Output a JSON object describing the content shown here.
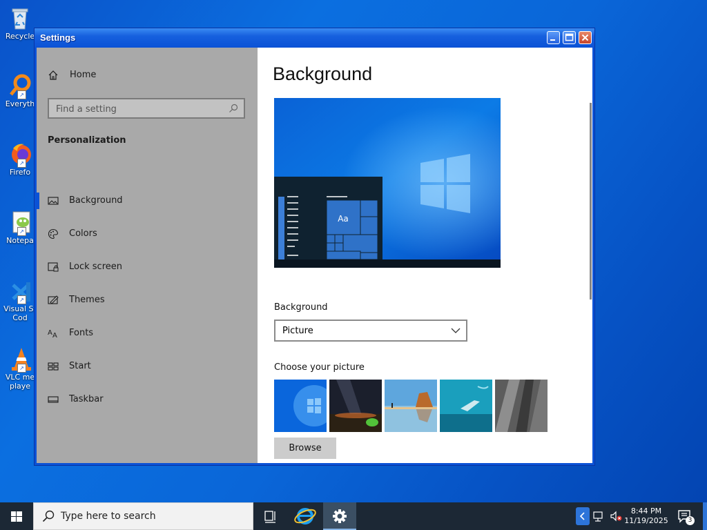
{
  "desktop": {
    "icons": [
      {
        "label": "Recycle",
        "icon": "recycle-bin-icon"
      },
      {
        "label": "Everyth",
        "icon": "everything-search-icon"
      },
      {
        "label": "Firefo",
        "icon": "firefox-icon"
      },
      {
        "label": "Notepa",
        "icon": "notepad-plus-plus-icon"
      },
      {
        "label": "Visual St Cod",
        "icon": "vscode-icon"
      },
      {
        "label": "VLC me playe",
        "icon": "vlc-icon"
      }
    ]
  },
  "window": {
    "title": "Settings",
    "controls": {
      "minimize": "minimize-icon",
      "maximize": "maximize-icon",
      "close": "close-icon"
    }
  },
  "nav": {
    "home_label": "Home",
    "search_placeholder": "Find a setting",
    "section_title": "Personalization",
    "items": [
      {
        "label": "Background",
        "icon": "picture-icon",
        "selected": true
      },
      {
        "label": "Colors",
        "icon": "palette-icon",
        "selected": false
      },
      {
        "label": "Lock screen",
        "icon": "lock-screen-icon",
        "selected": false
      },
      {
        "label": "Themes",
        "icon": "themes-icon",
        "selected": false
      },
      {
        "label": "Fonts",
        "icon": "fonts-icon",
        "selected": false
      },
      {
        "label": "Start",
        "icon": "start-icon",
        "selected": false
      },
      {
        "label": "Taskbar",
        "icon": "taskbar-icon",
        "selected": false
      }
    ]
  },
  "content": {
    "title": "Background",
    "preview_tile_text": "Aa",
    "background_label": "Background",
    "background_value": "Picture",
    "choose_label": "Choose your picture",
    "browse_label": "Browse"
  },
  "taskbar": {
    "search_text": "Type here to search",
    "time": "8:44 PM",
    "date": "11/19/2025",
    "notification_count": "3"
  },
  "colors": {
    "accent": "#0b52d6",
    "nav_bg": "#a9a9a9",
    "taskbar_bg": "#1c2835"
  }
}
